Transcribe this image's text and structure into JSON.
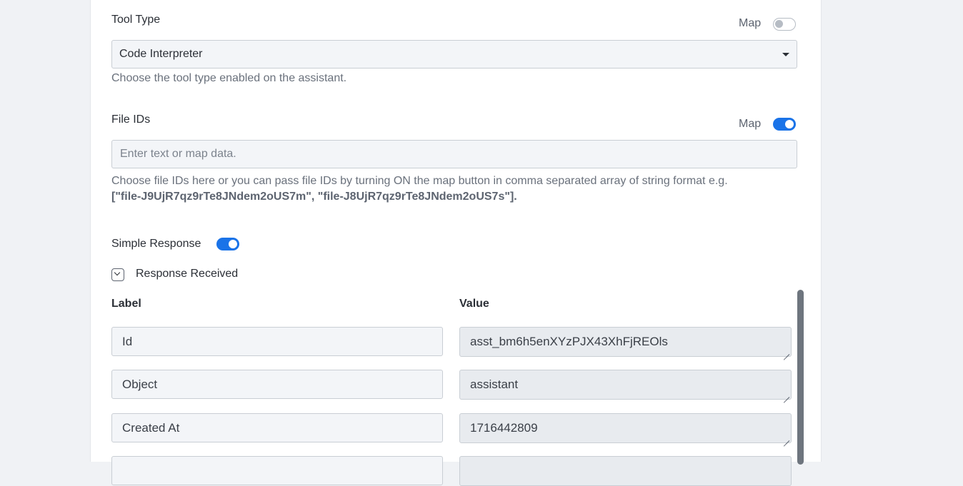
{
  "tool_type": {
    "label": "Tool Type",
    "map_label": "Map",
    "map_enabled": false,
    "selected": "Code Interpreter",
    "help": "Choose the tool type enabled on the assistant."
  },
  "file_ids": {
    "label": "File IDs",
    "map_label": "Map",
    "map_enabled": true,
    "placeholder": "Enter text or map data.",
    "help_text": "Choose file IDs here or you can pass file IDs by turning ON the map button in comma separated array of string format e.g.",
    "help_example": "[\"file-J9UjR7qz9rTe8JNdem2oUS7m\", \"file-J8UjR7qz9rTe8JNdem2oUS7s\"]."
  },
  "simple_response": {
    "label": "Simple Response",
    "enabled": true
  },
  "response_received": {
    "label": "Response Received",
    "col_label": "Label",
    "col_value": "Value",
    "rows": [
      {
        "label": "Id",
        "value": "asst_bm6h5enXYzPJX43XhFjREOls"
      },
      {
        "label": "Object",
        "value": "assistant"
      },
      {
        "label": "Created At",
        "value": "1716442809"
      },
      {
        "label": "",
        "value": ""
      }
    ]
  },
  "icons": {
    "select_caret": "caret-down-icon",
    "collapse": "chevron-down-icon",
    "resize": "resize-grip-icon"
  },
  "colors": {
    "accent": "#1a73e8",
    "toggle_off": "#b6bcc4",
    "scrollbar": "#6e757e"
  }
}
